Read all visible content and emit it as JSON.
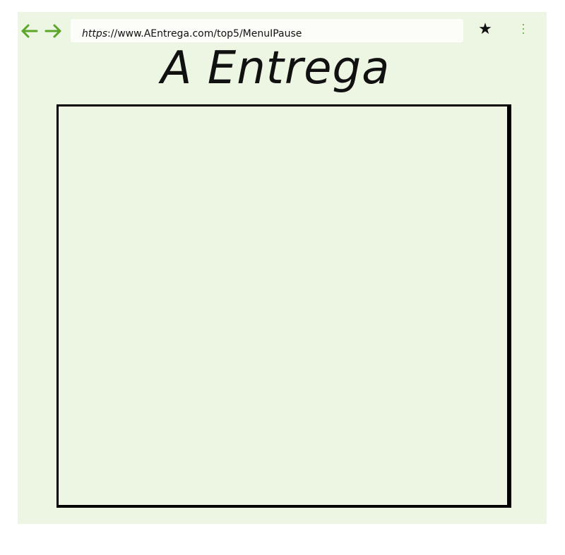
{
  "browser": {
    "back_icon": "arrow-left-icon",
    "forward_icon": "arrow-right-icon",
    "nav_icon_color": "#5aa52a",
    "url_scheme": "https",
    "url_rest": "://www.AEntrega.com/top5/MenuIPause",
    "bookmark_icon": "star-icon",
    "bookmark_glyph": "★",
    "menu_icon": "kebab-menu-icon"
  },
  "page": {
    "title": "A Entrega",
    "background_color": "#ecf6e2"
  }
}
